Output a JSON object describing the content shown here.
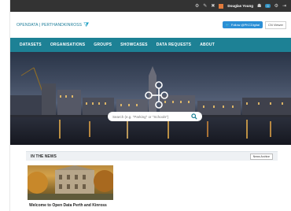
{
  "admin_bar": {
    "user_name": "Douglas Young",
    "count_badge": "0"
  },
  "header": {
    "logo_text": "OPENDATA | PERTHANDKINROSS",
    "twitter_button": "Follow @PKCDigital",
    "language_button": "CN Viewer"
  },
  "nav": {
    "items": [
      "DATASETS",
      "ORGANISATIONS",
      "GROUPS",
      "SHOWCASES",
      "DATA REQUESTS",
      "ABOUT"
    ]
  },
  "hero": {
    "search_placeholder": "Search (e.g. \"Parking\" or \"Schools\")"
  },
  "news": {
    "title": "IN THE NEWS",
    "archive_button": "News Archive",
    "cards": [
      {
        "caption": "Welcome to Open Data Perth and Kinross"
      }
    ]
  },
  "colors": {
    "nav_bg": "#1d8195",
    "admin_bar_bg": "#333333",
    "twitter_blue": "#2c8fd6",
    "logo_teal": "#1b7c99"
  }
}
